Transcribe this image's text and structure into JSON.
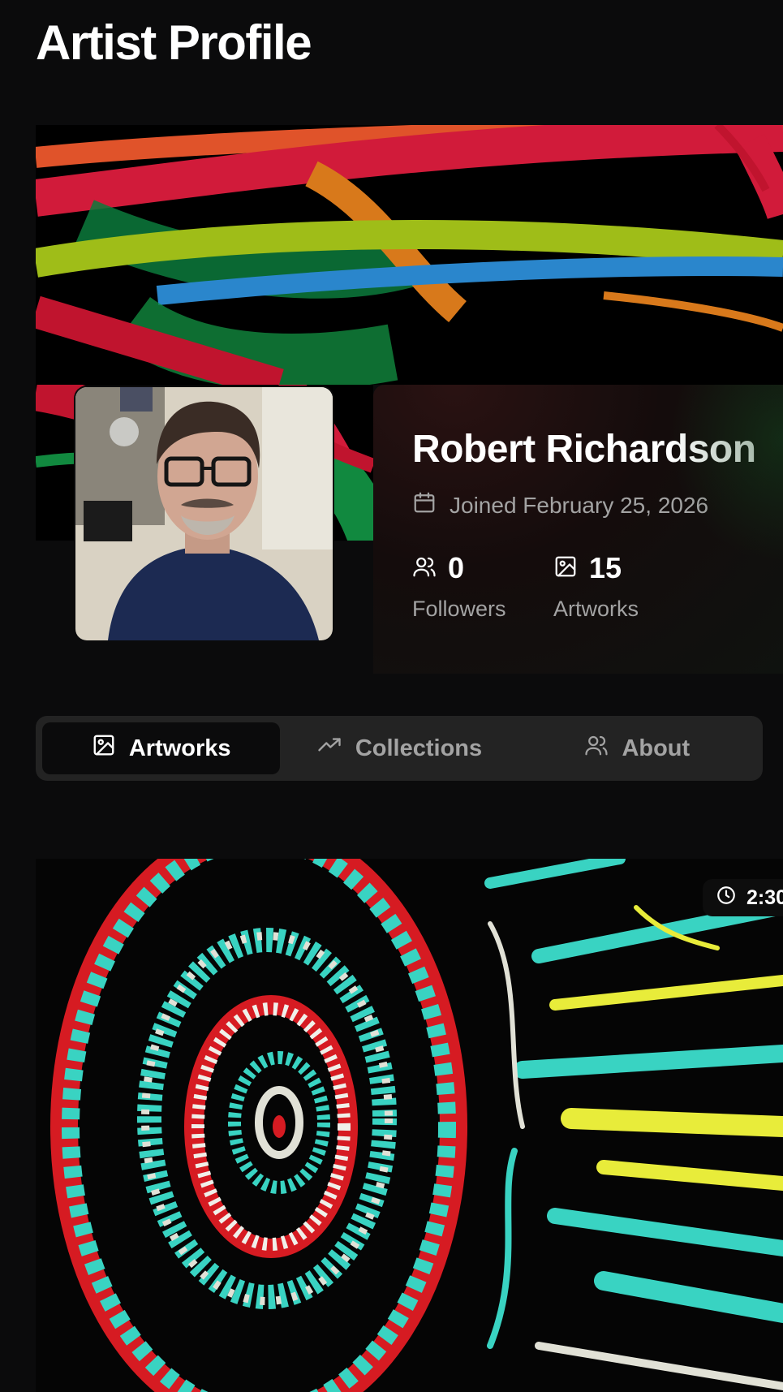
{
  "header": {
    "title": "Artist Profile"
  },
  "profile": {
    "name": "Robert Richardson",
    "joined": "Joined February 25, 2026",
    "stats": {
      "followers_value": "0",
      "followers_label": "Followers",
      "artworks_value": "15",
      "artworks_label": "Artworks"
    }
  },
  "tabs": [
    {
      "label": "Artworks",
      "icon": "image-icon",
      "active": true
    },
    {
      "label": "Collections",
      "icon": "trending-up-icon",
      "active": false
    },
    {
      "label": "About",
      "icon": "users-icon",
      "active": false
    }
  ],
  "artwork": {
    "duration": "2:30"
  },
  "colors": {
    "background": "#0b0b0c",
    "tab_bar": "#232323",
    "muted_text": "#a3a3a3"
  }
}
